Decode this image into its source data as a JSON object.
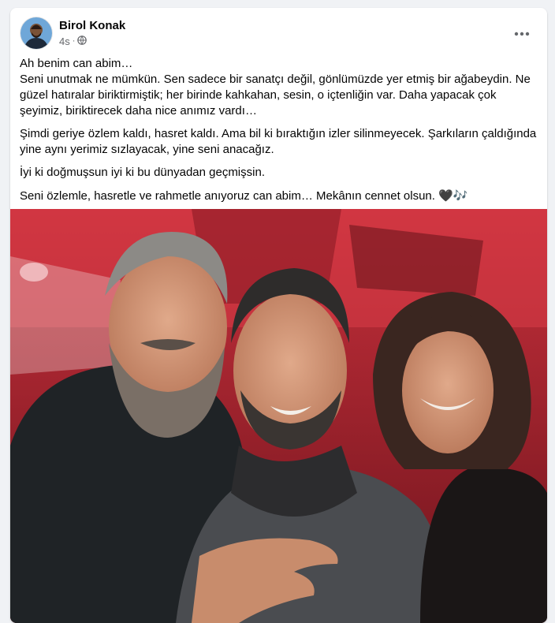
{
  "post": {
    "author": "Birol Konak",
    "time": "4s",
    "audience_icon": "globe-icon",
    "more_icon": "more-options-icon",
    "paragraphs": [
      [
        "Ah benim can abim…",
        "Seni unutmak ne mümkün. Sen sadece bir sanatçı değil, gönlümüzde yer etmiş bir ağabeydin. Ne güzel hatıralar biriktirmiştik; her birinde kahkahan, sesin, o içtenliğin var. Daha yapacak çok şeyimiz, biriktirecek daha nice anımız vardı…"
      ],
      [
        "Şimdi geriye özlem kaldı, hasret kaldı. Ama bil ki bıraktığın izler silinmeyecek. Şarkıların çaldığında yine aynı yerimiz sızlayacak, yine seni anacağız."
      ],
      [
        "İyi ki doğmuşsun iyi ki bu dünyadan geçmişsin."
      ],
      [
        "Seni özlemle, hasretle ve rahmetle anıyoruz can abim… Mekânın cennet olsun. 🖤🎶"
      ]
    ]
  },
  "colors": {
    "background": "#f0f2f5",
    "card": "#ffffff",
    "text_primary": "#050505",
    "text_secondary": "#65676b",
    "photo_backdrop": "#b3202c"
  }
}
